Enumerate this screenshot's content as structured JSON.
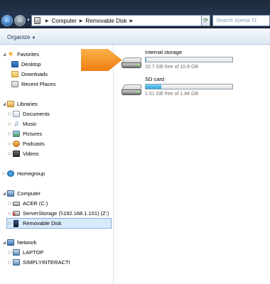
{
  "address_bar": {
    "crumbs": [
      "Computer",
      "Removable Disk"
    ],
    "search_placeholder": "Search Xperia TL"
  },
  "toolbar": {
    "organize_label": "Organize"
  },
  "nav": {
    "favorites": {
      "label": "Favorites",
      "items": [
        {
          "label": "Desktop",
          "icon": "desktop-icon"
        },
        {
          "label": "Downloads",
          "icon": "folder-icon"
        },
        {
          "label": "Recent Places",
          "icon": "recent-places-icon"
        }
      ]
    },
    "libraries": {
      "label": "Libraries",
      "items": [
        {
          "label": "Documents",
          "icon": "documents-icon"
        },
        {
          "label": "Music",
          "icon": "music-icon"
        },
        {
          "label": "Pictures",
          "icon": "pictures-icon"
        },
        {
          "label": "Podcasts",
          "icon": "podcasts-icon"
        },
        {
          "label": "Videos",
          "icon": "videos-icon"
        }
      ]
    },
    "homegroup": {
      "label": "Homegroup"
    },
    "computer": {
      "label": "Computer",
      "items": [
        {
          "label": "ACER (C:)",
          "icon": "drive-icon"
        },
        {
          "label": "ServerStorage (\\\\192.168.1.101) (Z:)",
          "icon": "network-drive-icon"
        },
        {
          "label": "Removable Disk",
          "icon": "device-icon",
          "selected": true
        }
      ]
    },
    "network": {
      "label": "Network",
      "items": [
        {
          "label": "LAPTOP",
          "icon": "computer-icon"
        },
        {
          "label": "SIMPLYINTERACTI",
          "icon": "computer-icon"
        }
      ]
    }
  },
  "drives": [
    {
      "name": "Internal storage",
      "free_text": "10.7 GB free of 10.8 GB",
      "used_fraction": 0.01
    },
    {
      "name": "SD card",
      "free_text": "1.51 GB free of 1.84 GB",
      "used_fraction": 0.18
    }
  ],
  "colors": {
    "callout": "#f58a1f",
    "bar_fill": "#27a4dd",
    "selection": "#d9ebfb"
  }
}
